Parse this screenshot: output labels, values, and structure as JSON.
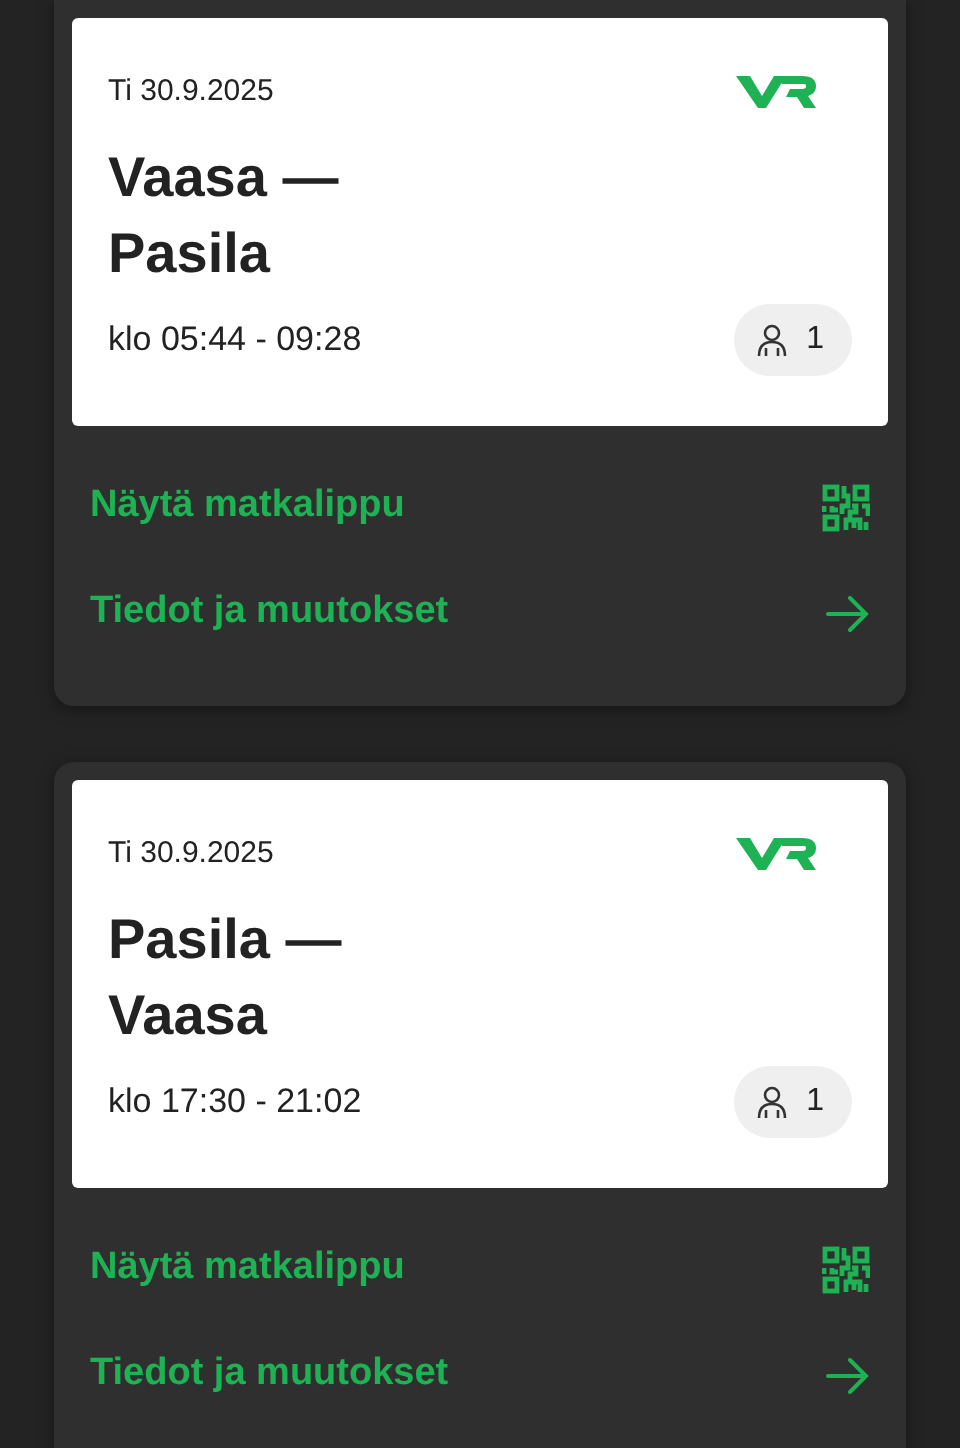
{
  "tickets": [
    {
      "date": "Ti 30.9.2025",
      "route": "Vaasa —\nPasila",
      "time": "klo 05:44 - 09:28",
      "passengers": "1",
      "links": [
        {
          "label": "Näytä matkalippu",
          "kind": "qr"
        },
        {
          "label": "Tiedot ja muutokset",
          "kind": "arrow"
        }
      ]
    },
    {
      "date": "Ti 30.9.2025",
      "route": "Pasila —\nVaasa",
      "time": "klo 17:30 - 21:02",
      "passengers": "1",
      "links": [
        {
          "label": "Näytä matkalippu",
          "kind": "qr"
        },
        {
          "label": "Tiedot ja muutokset",
          "kind": "arrow"
        }
      ]
    }
  ]
}
